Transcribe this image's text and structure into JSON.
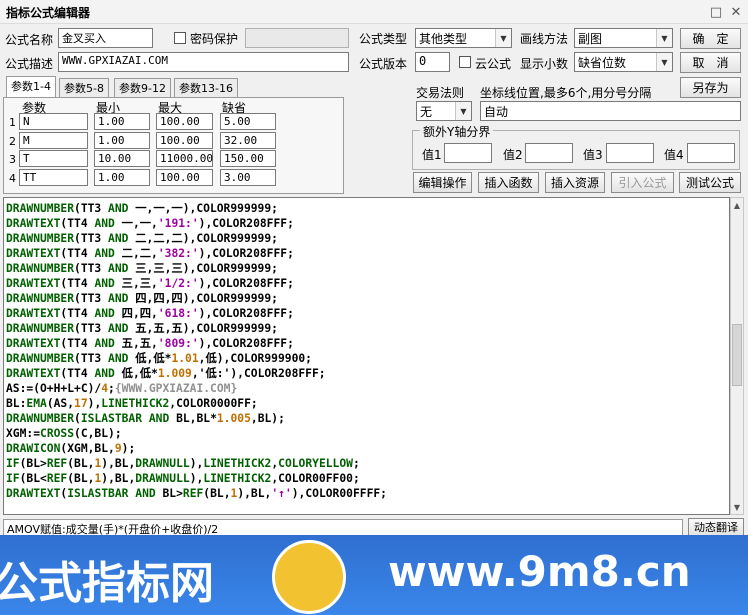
{
  "window": {
    "title": "指标公式编辑器",
    "minimize_glyph": "□",
    "close_glyph": "✕"
  },
  "formula": {
    "name_label": "公式名称",
    "name_value": "金叉买入",
    "password_label": "密码保护",
    "password_value": "",
    "desc_label": "公式描述",
    "desc_value": "WWW.GPXIAZAI.COM",
    "type_label": "公式类型",
    "type_value": "其他类型",
    "draw_label": "画线方法",
    "draw_value": "副图",
    "version_label": "公式版本",
    "version_value": "0",
    "cloud_label": "云公式",
    "decimals_label": "显示小数",
    "decimals_value": "缺省位数",
    "trade_rule_label": "交易法则",
    "trade_rule_value": "无",
    "coord_label": "坐标线位置,最多6个,用分号分隔",
    "coord_value": "自动",
    "yaxis_group_label": "额外Y轴分界",
    "yaxis_values": [
      {
        "label": "值1",
        "value": ""
      },
      {
        "label": "值2",
        "value": ""
      },
      {
        "label": "值3",
        "value": ""
      },
      {
        "label": "值4",
        "value": ""
      }
    ]
  },
  "buttons": {
    "ok": "确　定",
    "cancel": "取　消",
    "save_as": "另存为",
    "edit_ops": "编辑操作",
    "insert_func": "插入函数",
    "insert_res": "插入资源",
    "import_formula": "引入公式",
    "test_formula": "测试公式",
    "dynamic_translate": "动态翻译"
  },
  "tabs": [
    "参数1-4",
    "参数5-8",
    "参数9-12",
    "参数13-16"
  ],
  "params": {
    "headers": [
      "参数",
      "最小",
      "最大",
      "缺省"
    ],
    "rows": [
      {
        "idx": "1",
        "name": "N",
        "min": "1.00",
        "max": "100.00",
        "def": "5.00"
      },
      {
        "idx": "2",
        "name": "M",
        "min": "1.00",
        "max": "100.00",
        "def": "32.00"
      },
      {
        "idx": "3",
        "name": "T",
        "min": "10.00",
        "max": "11000.00",
        "def": "150.00"
      },
      {
        "idx": "4",
        "name": "TT",
        "min": "1.00",
        "max": "100.00",
        "def": "3.00"
      }
    ]
  },
  "code_lines": [
    [
      [
        "k",
        "DRAWNUMBER"
      ],
      [
        "t",
        "(TT3 "
      ],
      [
        "k",
        "AND"
      ],
      [
        "t",
        " 一,一,一),COLOR999999;"
      ]
    ],
    [
      [
        "k",
        "DRAWTEXT"
      ],
      [
        "t",
        "(TT4 "
      ],
      [
        "k",
        "AND"
      ],
      [
        "t",
        " 一,一,"
      ],
      [
        "s",
        "'191:'"
      ],
      [
        "t",
        "),COLOR208FFF;"
      ]
    ],
    [
      [
        "k",
        "DRAWNUMBER"
      ],
      [
        "t",
        "(TT3 "
      ],
      [
        "k",
        "AND"
      ],
      [
        "t",
        " 二,二,二),COLOR999999;"
      ]
    ],
    [
      [
        "k",
        "DRAWTEXT"
      ],
      [
        "t",
        "(TT4 "
      ],
      [
        "k",
        "AND"
      ],
      [
        "t",
        " 二,二,"
      ],
      [
        "s",
        "'382:'"
      ],
      [
        "t",
        "),COLOR208FFF;"
      ]
    ],
    [
      [
        "k",
        "DRAWNUMBER"
      ],
      [
        "t",
        "(TT3 "
      ],
      [
        "k",
        "AND"
      ],
      [
        "t",
        " 三,三,三),COLOR999999;"
      ]
    ],
    [
      [
        "k",
        "DRAWTEXT"
      ],
      [
        "t",
        "(TT4 "
      ],
      [
        "k",
        "AND"
      ],
      [
        "t",
        " 三,三,"
      ],
      [
        "s",
        "'1/2:'"
      ],
      [
        "t",
        "),COLOR208FFF;"
      ]
    ],
    [
      [
        "k",
        "DRAWNUMBER"
      ],
      [
        "t",
        "(TT3 "
      ],
      [
        "k",
        "AND"
      ],
      [
        "t",
        " 四,四,四),COLOR999999;"
      ]
    ],
    [
      [
        "k",
        "DRAWTEXT"
      ],
      [
        "t",
        "(TT4 "
      ],
      [
        "k",
        "AND"
      ],
      [
        "t",
        " 四,四,"
      ],
      [
        "s",
        "'618:'"
      ],
      [
        "t",
        "),COLOR208FFF;"
      ]
    ],
    [
      [
        "k",
        "DRAWNUMBER"
      ],
      [
        "t",
        "(TT3 "
      ],
      [
        "k",
        "AND"
      ],
      [
        "t",
        " 五,五,五),COLOR999999;"
      ]
    ],
    [
      [
        "k",
        "DRAWTEXT"
      ],
      [
        "t",
        "(TT4 "
      ],
      [
        "k",
        "AND"
      ],
      [
        "t",
        " 五,五,"
      ],
      [
        "s",
        "'809:'"
      ],
      [
        "t",
        "),COLOR208FFF;"
      ]
    ],
    [
      [
        "k",
        "DRAWNUMBER"
      ],
      [
        "t",
        "(TT3 "
      ],
      [
        "k",
        "AND"
      ],
      [
        "t",
        " 低,低*"
      ],
      [
        "n",
        "1.01"
      ],
      [
        "t",
        ",低),COLOR999900;"
      ]
    ],
    [
      [
        "k",
        "DRAWTEXT"
      ],
      [
        "t",
        "(TT4 "
      ],
      [
        "k",
        "AND"
      ],
      [
        "t",
        " 低,低*"
      ],
      [
        "n",
        "1.009"
      ],
      [
        "t",
        ",'低:'),COLOR208FFF;"
      ]
    ],
    [
      [
        "t",
        "AS:=(O+H+L+C)/"
      ],
      [
        "n",
        "4"
      ],
      [
        "t",
        ";"
      ],
      [
        "c",
        "{WWW.GPXIAZAI.COM}"
      ]
    ],
    [
      [
        "t",
        "BL:"
      ],
      [
        "k",
        "EMA"
      ],
      [
        "t",
        "(AS,"
      ],
      [
        "n",
        "17"
      ],
      [
        "t",
        "),"
      ],
      [
        "k",
        "LINETHICK2"
      ],
      [
        "t",
        ",COLOR0000FF;"
      ]
    ],
    [
      [
        "k",
        "DRAWNUMBER"
      ],
      [
        "t",
        "("
      ],
      [
        "k",
        "ISLASTBAR"
      ],
      [
        "t",
        " "
      ],
      [
        "k",
        "AND"
      ],
      [
        "t",
        " BL,BL*"
      ],
      [
        "n",
        "1.005"
      ],
      [
        "t",
        ",BL);"
      ]
    ],
    [
      [
        "t",
        "XGM:="
      ],
      [
        "k",
        "CROSS"
      ],
      [
        "t",
        "(C,BL);"
      ]
    ],
    [
      [
        "k",
        "DRAWICON"
      ],
      [
        "t",
        "(XGM,BL,"
      ],
      [
        "n",
        "9"
      ],
      [
        "t",
        ");"
      ]
    ],
    [
      [
        "k",
        "IF"
      ],
      [
        "t",
        "(BL>"
      ],
      [
        "k",
        "REF"
      ],
      [
        "t",
        "(BL,"
      ],
      [
        "n",
        "1"
      ],
      [
        "t",
        "),BL,"
      ],
      [
        "k",
        "DRAWNULL"
      ],
      [
        "t",
        "),"
      ],
      [
        "k",
        "LINETHICK2"
      ],
      [
        "t",
        ","
      ],
      [
        "k",
        "COLORYELLOW"
      ],
      [
        "t",
        ";"
      ]
    ],
    [
      [
        "k",
        "IF"
      ],
      [
        "t",
        "(BL<"
      ],
      [
        "k",
        "REF"
      ],
      [
        "t",
        "(BL,"
      ],
      [
        "n",
        "1"
      ],
      [
        "t",
        "),BL,"
      ],
      [
        "k",
        "DRAWNULL"
      ],
      [
        "t",
        "),"
      ],
      [
        "k",
        "LINETHICK2"
      ],
      [
        "t",
        ",COLOR00FF00;"
      ]
    ],
    [
      [
        "k",
        "DRAWTEXT"
      ],
      [
        "t",
        "("
      ],
      [
        "k",
        "ISLASTBAR"
      ],
      [
        "t",
        " "
      ],
      [
        "k",
        "AND"
      ],
      [
        "t",
        " BL>"
      ],
      [
        "k",
        "REF"
      ],
      [
        "t",
        "(BL,"
      ],
      [
        "n",
        "1"
      ],
      [
        "t",
        "),BL,"
      ],
      [
        "s",
        "'↑'"
      ],
      [
        "t",
        "),COLOR00FFFF;"
      ]
    ]
  ],
  "code_colors": {
    "k": "#006000",
    "t": "#000000",
    "s": "#a000a0",
    "n": "#c07000",
    "c": "#909090"
  },
  "status_text": "AMOV赋值:成交量(手)*(开盘价+收盘价)/2",
  "banner": {
    "left_text": "公式指标网",
    "right_text": "www.9m8.cn"
  },
  "icons": {
    "scroll_up": "▲",
    "scroll_down": "▼",
    "dropdown": "▼"
  }
}
